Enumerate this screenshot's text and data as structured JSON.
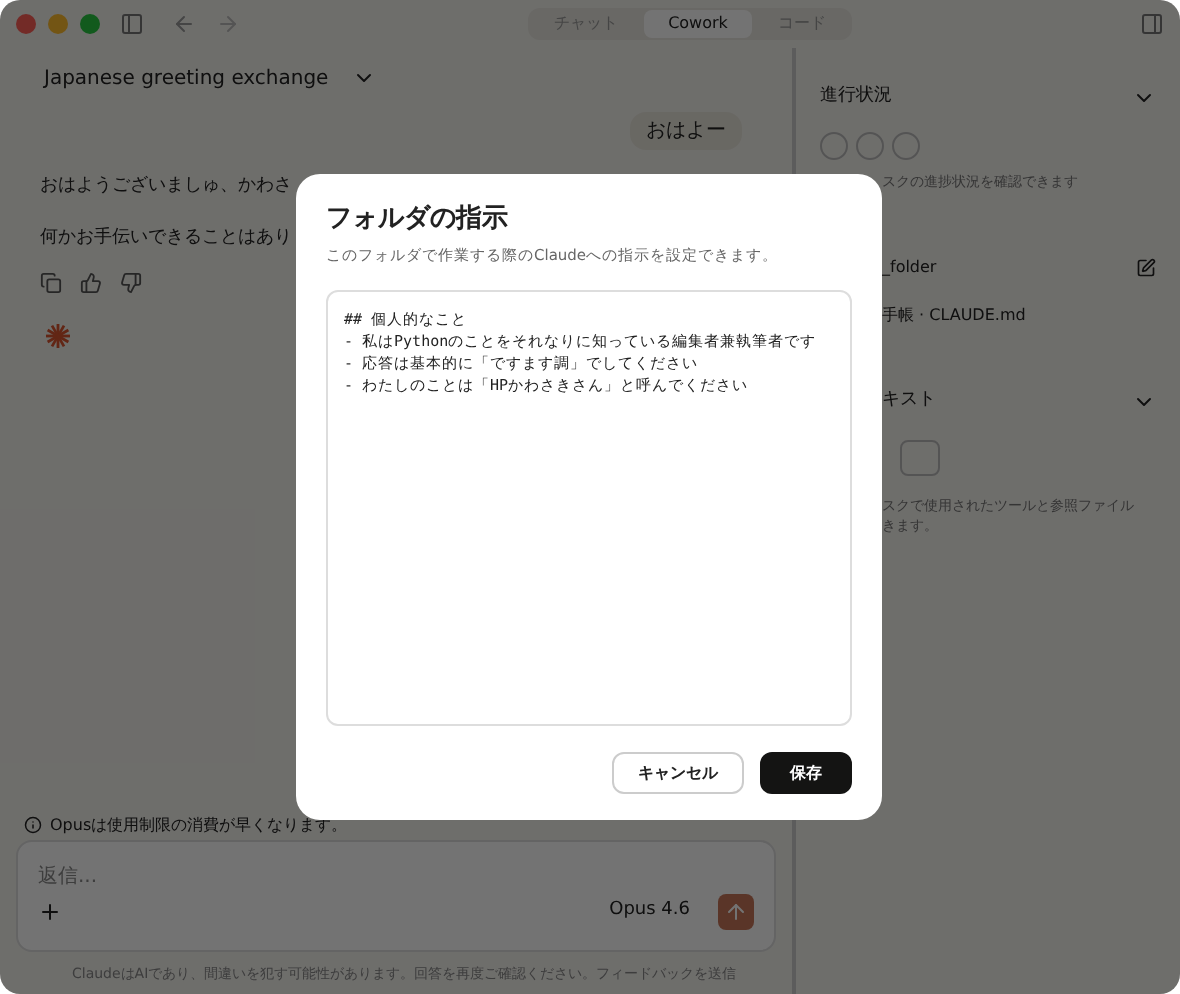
{
  "window": {
    "tabs": [
      {
        "label": "チャット",
        "selected": false
      },
      {
        "label": "Cowork",
        "selected": true
      },
      {
        "label": "コード",
        "selected": false
      }
    ]
  },
  "conversation": {
    "title": "Japanese greeting exchange",
    "user_message": "おはよー",
    "assistant_lines": [
      "おはようございましゅ、かわさ",
      "何かお手伝いできることはあり"
    ]
  },
  "side_panel": {
    "progress_title": "進行状況",
    "progress_text": "スクの進捗状況を確認できます",
    "folder_name": "_folder",
    "folder_file": "手帳 · CLAUDE.md",
    "context_title": "キスト",
    "context_text": "スクで使用されたツールと参照ファイル",
    "context_text_2": "きます。"
  },
  "composer": {
    "notice": "Opusは使用制限の消費が早くなります。",
    "placeholder": "返信...",
    "model": "Opus 4.6",
    "disclaimer": "ClaudeはAIであり、間違いを犯す可能性があります。回答を再度ご確認ください。フィードバックを送信"
  },
  "dialog": {
    "title": "フォルダの指示",
    "subtitle": "このフォルダで作業する際のClaudeへの指示を設定できます。",
    "instructions": "## 個人的なこと\n- 私はPythonのことをそれなりに知っている編集者兼執筆者です\n- 応答は基本的に「ですます調」でしてください\n- わたしのことは「HPかわさきさん」と呼んでください",
    "buttons": [
      {
        "label": "キャンセル",
        "kind": "secondary"
      },
      {
        "label": "保存",
        "kind": "primary"
      }
    ]
  }
}
